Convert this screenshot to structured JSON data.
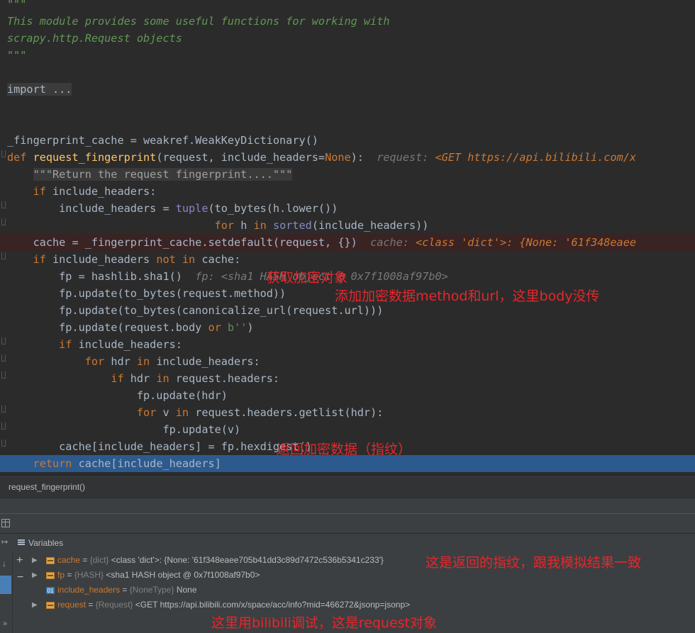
{
  "code_lines": {
    "l0": "\"\"\"",
    "l1": "This module provides some useful functions for working with",
    "l2": "scrapy.http.Request objects",
    "l3": "\"\"\"",
    "l5": "import ...",
    "l8_a": "_fingerprint_cache = weakref.WeakKeyDictionary()",
    "l9_def": "def",
    "l9_name": "request_fingerprint",
    "l9_args": "(request, include_headers=",
    "l9_none": "None",
    "l9_end": "):",
    "l9_hint_label": "request:",
    "l9_hint_value": "<GET https://api.bilibili.com/x",
    "l10": "\"\"\"Return the request fingerprint....\"\"\"",
    "l11_if": "if",
    "l11_rest": " include_headers:",
    "l12_a": "include_headers = ",
    "l12_tuple": "tuple",
    "l12_b": "(to_bytes(h.lower())",
    "l13_for": "for",
    "l13_a": " h ",
    "l13_in": "in",
    "l13_sorted": "sorted",
    "l13_b": "(include_headers))",
    "l14_a": "cache = _fingerprint_cache.setdefault(request, {})",
    "l14_hint_label": "cache:",
    "l14_hint_value": "<class 'dict'>: {None: '61f348eaee",
    "l15_if": "if",
    "l15_a": " include_headers ",
    "l15_not": "not in",
    "l15_b": " cache:",
    "l16_a": "fp = hashlib.sha1()",
    "l16_hint": "fp: <sha1 HASH object @ 0x7f1008af97b0>",
    "l17": "fp.update(to_bytes(request.method))",
    "l18": "fp.update(to_bytes(canonicalize_url(request.url)))",
    "l19_a": "fp.update(request.body ",
    "l19_or": "or",
    "l19_b": " b''",
    "l19_c": ")",
    "l20_if": "if",
    "l20_rest": " include_headers:",
    "l21_for": "for",
    "l21_a": " hdr ",
    "l21_in": "in",
    "l21_b": " include_headers:",
    "l22_if": "if",
    "l22_a": " hdr ",
    "l22_in": "in",
    "l22_b": " request.headers:",
    "l23": "fp.update(hdr)",
    "l24_for": "for",
    "l24_a": " v ",
    "l24_in": "in",
    "l24_b": " request.headers.getlist(hdr):",
    "l25": "fp.update(v)",
    "l26": "cache[include_headers] = fp.hexdigest()",
    "l27_return": "return",
    "l27_rest": " cache[include_headers]"
  },
  "annotations": {
    "a1": "获取加密对象",
    "a2": "添加加密数据method和url，这里body没传",
    "a3": "返回加密数据（指纹）",
    "a4": "这是返回的指纹，跟我模拟结果一致",
    "a5": "这里用bilibili调试，这是request对象"
  },
  "breadcrumb": "request_fingerprint()",
  "variables_panel": {
    "title": "Variables",
    "items": [
      {
        "name": "cache",
        "type": "{dict}",
        "value": "<class 'dict'>: {None: '61f348eaee705b41dd3c89d7472c536b5341c233'}",
        "expandable": true,
        "icon": "dict-icon"
      },
      {
        "name": "fp",
        "type": "{HASH}",
        "value": "<sha1 HASH object @ 0x7f1008af97b0>",
        "expandable": true,
        "icon": "object-icon"
      },
      {
        "name": "include_headers",
        "type": "{NoneType}",
        "value": "None",
        "expandable": false,
        "icon": "01",
        "icon_label": "01"
      },
      {
        "name": "request",
        "type": "{Request}",
        "value": "<GET https://api.bilibili.com/x/space/acc/info?mid=466272&jsonp=jsonp>",
        "expandable": true,
        "icon": "object-icon"
      }
    ]
  },
  "colors": {
    "editor_bg": "#2b2b2b",
    "keyword": "#cc7832",
    "function": "#ffc66d",
    "docstring": "#629755",
    "current_line": "#2d5a8e",
    "breakpoint_line": "#3a2323",
    "annotation": "#e8262b"
  }
}
